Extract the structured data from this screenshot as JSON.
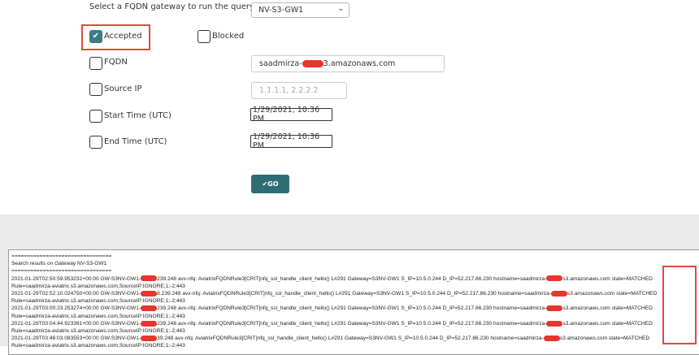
{
  "form": {
    "gateway_label": "Select a FQDN gateway to run the query",
    "gateway_selected": "NV-S3-GW1",
    "accepted_label": "Accepted",
    "blocked_label": "Blocked",
    "fqdn_label": "FQDN",
    "fqdn_value_prefix": "saadmirza-",
    "fqdn_value_suffix": "3.amazonaws.com",
    "source_ip_label": "Source IP",
    "source_ip_placeholder": "1.1.1.1, 2.2.2.2",
    "start_time_label": "Start Time (UTC)",
    "start_time_value": "1/29/2021, 10:36 PM",
    "end_time_label": "End Time (UTC)",
    "end_time_value": "1/29/2021, 10:36 PM",
    "go_label": "GO",
    "accepted_checked": true,
    "blocked_checked": false
  },
  "results": {
    "separator": "================================",
    "header": "Search results on Gateway NV-S3-GW1",
    "entries": [
      {
        "line1_a": "2021-01-29T02:50:59.953232+00:00 GW-S3NV-GW1-",
        "line1_b": "239.248 avx-nfq: AviatrixFQDNRule3[CRIT]nfq_ssl_handle_client_hello() L#291  Gateway=S3NV-GW1 S_IP=10.5.0.244 D_IP=52.217.86.230 hostname=saadmirza-",
        "line1_c": "s3.amazonaws.com state=MATCHED",
        "line2": "Rule=saadmirza-aviatrix.s3.amazonaws.com,SourceIP:IGNORE;1;-2;443"
      },
      {
        "line1_a": "2021-01-29T02:52:10.024750+00:00 GW-S3NV-GW1-",
        "line1_b": "8.239.248 avx-nfq: AviatrixFQDNRule3[CRIT]nfq_ssl_handle_client_hello() L#291  Gateway=S3NV-GW1 S_IP=10.5.0.244 D_IP=52.217.86.230 hostname=saadmirza-",
        "line1_c": "s3.amazonaws.com state=MATCHED",
        "line2": "Rule=saadmirza-aviatrix.s3.amazonaws.com,SourceIP:IGNORE;1;-2;443"
      },
      {
        "line1_a": "2021-01-29T03:00:23.253274+00:00 GW-S3NV-GW1-",
        "line1_b": "239.248 avx-nfq: AviatrixFQDNRule3[CRIT]nfq_ssl_handle_client_hello() L#291  Gateway=S3NV-GW1 S_IP=10.5.0.244 D_IP=52.217.86.230 hostname=saadmirza-",
        "line1_c": "s3.amazonaws.com state=MATCHED",
        "line2": "Rule=saadmirza-aviatrix.s3.amazonaws.com,SourceIP:IGNORE;1;-2;443"
      },
      {
        "line1_a": "2021-01-29T03:04:44.923391+00:00 GW-S3NV-GW1-",
        "line1_b": "239.248 avx-nfq: AviatrixFQDNRule3[CRIT]nfq_ssl_handle_client_hello() L#291  Gateway=S3NV-GW1 S_IP=10.5.0.244 D_IP=52.217.86.230 hostname=saadmirza-",
        "line1_c": "s3.amazonaws.com state=MATCHED",
        "line2": "Rule=saadmirza-aviatrix.s3.amazonaws.com,SourceIP:IGNORE;1;-2;443"
      },
      {
        "line1_a": "2021-01-29T03:46:03.083553+00:00 GW-S3NV-GW1-",
        "line1_b": "39.248 avx-nfq: AviatrixFQDNRule3[CRIT]nfq_ssl_handle_client_hello() L#291  Gateway=S3NV-GW1 S_IP=10.5.0.244 D_IP=52.217.86.230 hostname=saadmirza-",
        "line1_c": "s3.amazonaws.com state=MATCHED",
        "line2": "Rule=saadmirza-aviatrix.s3.amazonaws.com,SourceIP:IGNORE;1;-2;443"
      }
    ]
  },
  "colors": {
    "accent": "#2e6d73",
    "highlight": "#e04a3a",
    "redaction": "#e8352d"
  }
}
